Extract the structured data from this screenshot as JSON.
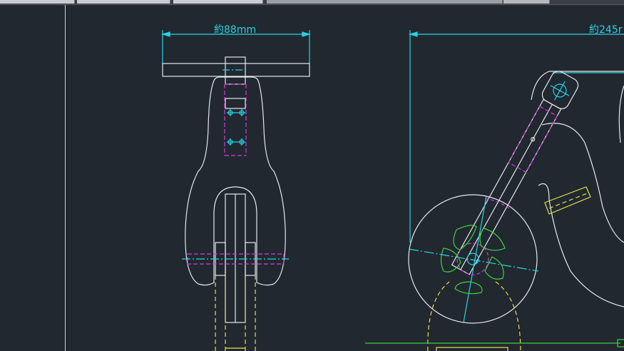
{
  "toolbar": {
    "segments": [
      "",
      "",
      "",
      "",
      ""
    ]
  },
  "drawing": {
    "front_view": {
      "width_dimension_label": "約88mm"
    },
    "side_view": {
      "length_dimension_label": "約245r"
    }
  },
  "colors": {
    "background": "#212830",
    "outline": "#e6e8ea",
    "dimension": "#29d3e3",
    "hidden_magenta": "#d63bd6",
    "hidden_yellow": "#e6e04a",
    "green": "#3bd23b"
  }
}
